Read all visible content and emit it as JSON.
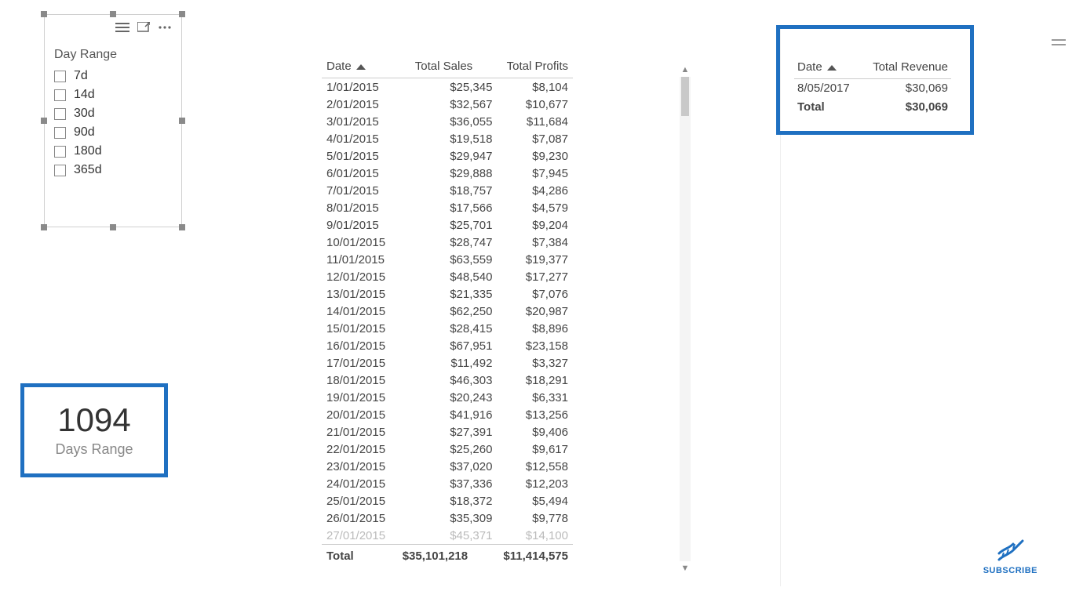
{
  "slicer": {
    "title": "Day Range",
    "options": [
      "7d",
      "14d",
      "30d",
      "90d",
      "180d",
      "365d"
    ]
  },
  "card": {
    "value": "1094",
    "label": "Days Range"
  },
  "main_table": {
    "columns": {
      "date": "Date",
      "sales": "Total Sales",
      "profits": "Total Profits"
    },
    "rows": [
      {
        "date": "1/01/2015",
        "sales": "$25,345",
        "profits": "$8,104"
      },
      {
        "date": "2/01/2015",
        "sales": "$32,567",
        "profits": "$10,677"
      },
      {
        "date": "3/01/2015",
        "sales": "$36,055",
        "profits": "$11,684"
      },
      {
        "date": "4/01/2015",
        "sales": "$19,518",
        "profits": "$7,087"
      },
      {
        "date": "5/01/2015",
        "sales": "$29,947",
        "profits": "$9,230"
      },
      {
        "date": "6/01/2015",
        "sales": "$29,888",
        "profits": "$7,945"
      },
      {
        "date": "7/01/2015",
        "sales": "$18,757",
        "profits": "$4,286"
      },
      {
        "date": "8/01/2015",
        "sales": "$17,566",
        "profits": "$4,579"
      },
      {
        "date": "9/01/2015",
        "sales": "$25,701",
        "profits": "$9,204"
      },
      {
        "date": "10/01/2015",
        "sales": "$28,747",
        "profits": "$7,384"
      },
      {
        "date": "11/01/2015",
        "sales": "$63,559",
        "profits": "$19,377"
      },
      {
        "date": "12/01/2015",
        "sales": "$48,540",
        "profits": "$17,277"
      },
      {
        "date": "13/01/2015",
        "sales": "$21,335",
        "profits": "$7,076"
      },
      {
        "date": "14/01/2015",
        "sales": "$62,250",
        "profits": "$20,987"
      },
      {
        "date": "15/01/2015",
        "sales": "$28,415",
        "profits": "$8,896"
      },
      {
        "date": "16/01/2015",
        "sales": "$67,951",
        "profits": "$23,158"
      },
      {
        "date": "17/01/2015",
        "sales": "$11,492",
        "profits": "$3,327"
      },
      {
        "date": "18/01/2015",
        "sales": "$46,303",
        "profits": "$18,291"
      },
      {
        "date": "19/01/2015",
        "sales": "$20,243",
        "profits": "$6,331"
      },
      {
        "date": "20/01/2015",
        "sales": "$41,916",
        "profits": "$13,256"
      },
      {
        "date": "21/01/2015",
        "sales": "$27,391",
        "profits": "$9,406"
      },
      {
        "date": "22/01/2015",
        "sales": "$25,260",
        "profits": "$9,617"
      },
      {
        "date": "23/01/2015",
        "sales": "$37,020",
        "profits": "$12,558"
      },
      {
        "date": "24/01/2015",
        "sales": "$37,336",
        "profits": "$12,203"
      },
      {
        "date": "25/01/2015",
        "sales": "$18,372",
        "profits": "$5,494"
      },
      {
        "date": "26/01/2015",
        "sales": "$35,309",
        "profits": "$9,778"
      },
      {
        "date": "27/01/2015",
        "sales": "$45,371",
        "profits": "$14,100"
      }
    ],
    "total": {
      "label": "Total",
      "sales": "$35,101,218",
      "profits": "$11,414,575"
    }
  },
  "revenue_table": {
    "columns": {
      "date": "Date",
      "revenue": "Total Revenue"
    },
    "rows": [
      {
        "date": "8/05/2017",
        "revenue": "$30,069"
      }
    ],
    "total": {
      "label": "Total",
      "revenue": "$30,069"
    }
  },
  "subscribe": {
    "label": "SUBSCRIBE"
  }
}
